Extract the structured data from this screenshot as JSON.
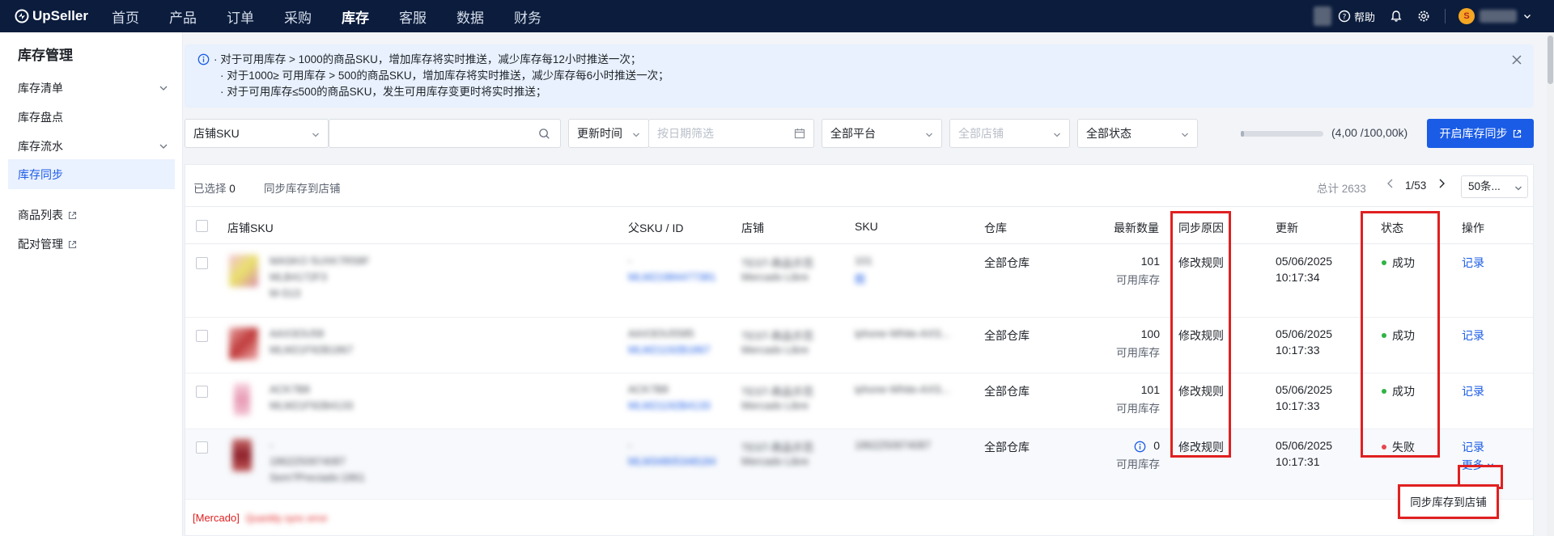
{
  "topbar": {
    "brand": "UpSeller",
    "nav": [
      "首页",
      "产品",
      "订单",
      "采购",
      "库存",
      "客服",
      "数据",
      "财务"
    ],
    "active_nav": "库存",
    "help_label": "帮助"
  },
  "sidebar": {
    "title": "库存管理",
    "items": [
      {
        "label": "库存清单"
      },
      {
        "label": "库存盘点"
      },
      {
        "label": "库存流水"
      },
      {
        "label": "库存同步"
      },
      {
        "label": "商品列表"
      },
      {
        "label": "配对管理"
      }
    ]
  },
  "notice": {
    "lines": [
      "· 对于可用库存 > 1000的商品SKU，增加库存将实时推送，减少库存每12小时推送一次；",
      "· 对于1000≥ 可用库存 > 500的商品SKU，增加库存将实时推送，减少库存每6小时推送一次；",
      "· 对于可用库存≤500的商品SKU，发生可用库存变更时将实时推送；"
    ]
  },
  "filters": {
    "sku_type": "店铺SKU",
    "search_value": "",
    "time_type": "更新时间",
    "date_placeholder": "按日期筛选",
    "platform": "全部平台",
    "store_placeholder": "全部店铺",
    "status": "全部状态"
  },
  "quota": {
    "text": "(4,00 /100,00k)",
    "fill_fraction": 0.04
  },
  "sync_button": "开启库存同步",
  "toolbar": {
    "selected_label": "已选择",
    "selected_count": "0",
    "sync_to_store": "同步库存到店铺",
    "total": "总计 2633",
    "page": "1/53",
    "page_size": "50条..."
  },
  "columns": {
    "store_sku": "店铺SKU",
    "parent_sku": "父SKU / ID",
    "store": "店铺",
    "sku": "SKU",
    "warehouse": "仓库",
    "latest_qty": "最新数量",
    "reason": "同步原因",
    "updated": "更新",
    "status": "状态",
    "action": "操作"
  },
  "rows": [
    {
      "warehouse": "全部仓库",
      "qty": "101",
      "qty_label": "可用库存",
      "reason": "修改规则",
      "date": "05/06/2025",
      "time": "10:17:34",
      "status": "成功",
      "action": "记录"
    },
    {
      "warehouse": "全部仓库",
      "qty": "100",
      "qty_label": "可用库存",
      "reason": "修改规则",
      "date": "05/06/2025",
      "time": "10:17:33",
      "status": "成功",
      "action": "记录"
    },
    {
      "warehouse": "全部仓库",
      "qty": "101",
      "qty_label": "可用库存",
      "reason": "修改规则",
      "date": "05/06/2025",
      "time": "10:17:33",
      "status": "成功",
      "action": "记录"
    },
    {
      "warehouse": "全部仓库",
      "qty": "0",
      "qty_label": "可用库存",
      "reason": "修改规则",
      "date": "05/06/2025",
      "time": "10:17:31",
      "status": "失败",
      "action": "记录",
      "more": "更多"
    }
  ],
  "popup_item": "同步库存到店铺",
  "footer_tag": "[Mercado]",
  "colors": {
    "primary": "#1b5ce6",
    "success": "#2fb344",
    "fail": "#e5484d",
    "highlight": "#e02020"
  }
}
